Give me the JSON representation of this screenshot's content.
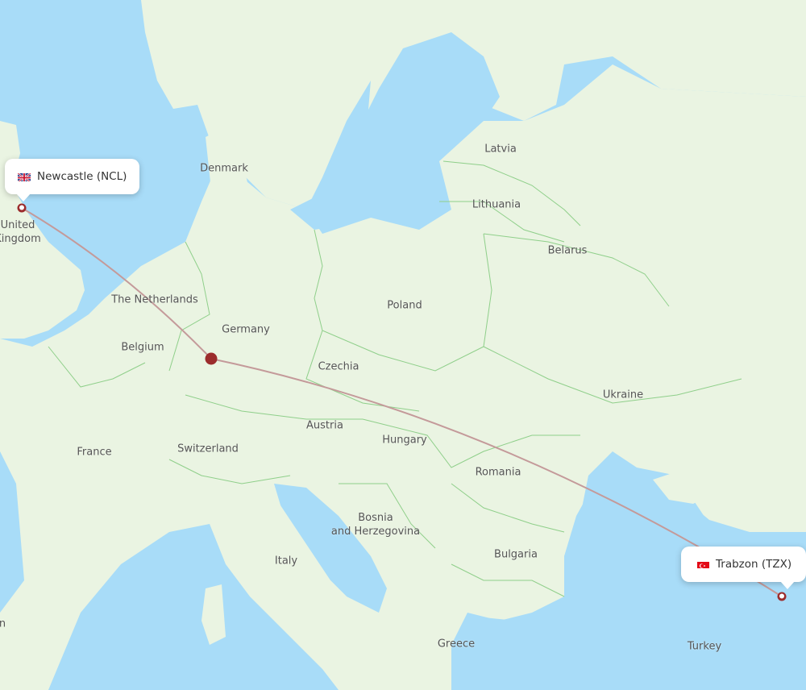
{
  "map": {
    "colors": {
      "water": "#a8dcf8",
      "land": "#eaf4e2",
      "land_shade": "#dfeed3",
      "border": "#8fcf8a",
      "route": "#c49a9a",
      "marker": "#9b2c2c"
    },
    "origin": {
      "name": "Newcastle (NCL)",
      "country_flag": "uk-flag"
    },
    "destination": {
      "name": "Trabzon (TZX)",
      "country_flag": "turkey-flag"
    },
    "stopover_marker": "Frankfurt area (unlabeled)",
    "country_labels": [
      {
        "id": "denmark",
        "text": "Denmark"
      },
      {
        "id": "latvia",
        "text": "Latvia"
      },
      {
        "id": "lithuania",
        "text": "Lithuania"
      },
      {
        "id": "belarus",
        "text": "Belarus"
      },
      {
        "id": "united-kingdom",
        "text": "United\nKingdom"
      },
      {
        "id": "netherlands",
        "text": "The Netherlands"
      },
      {
        "id": "germany",
        "text": "Germany"
      },
      {
        "id": "poland",
        "text": "Poland"
      },
      {
        "id": "belgium",
        "text": "Belgium"
      },
      {
        "id": "czechia",
        "text": "Czechia"
      },
      {
        "id": "ukraine",
        "text": "Ukraine"
      },
      {
        "id": "austria",
        "text": "Austria"
      },
      {
        "id": "hungary",
        "text": "Hungary"
      },
      {
        "id": "france",
        "text": "France"
      },
      {
        "id": "switzerland",
        "text": "Switzerland"
      },
      {
        "id": "romania",
        "text": "Romania"
      },
      {
        "id": "bosnia",
        "text": "Bosnia\nand Herzegovina"
      },
      {
        "id": "italy",
        "text": "Italy"
      },
      {
        "id": "bulgaria",
        "text": "Bulgaria"
      },
      {
        "id": "greece",
        "text": "Greece"
      },
      {
        "id": "turkey",
        "text": "Turkey"
      },
      {
        "id": "spain-partial",
        "text": "n"
      }
    ]
  }
}
